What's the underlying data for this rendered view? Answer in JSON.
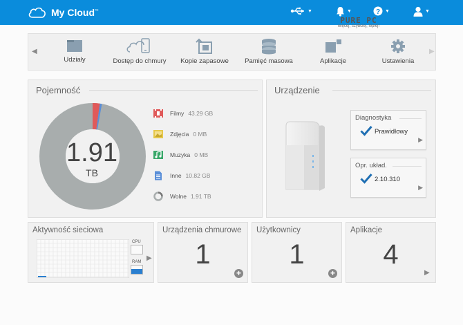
{
  "header": {
    "app_title": "My Cloud",
    "trademark": "™"
  },
  "watermark": {
    "brand": "PURE PC",
    "tagline": "więcej, szybciej, lepiej!"
  },
  "nav": {
    "items": [
      {
        "label": "Udziały",
        "icon": "folder-icon"
      },
      {
        "label": "Dostęp do chmury",
        "icon": "cloud-phone-icon"
      },
      {
        "label": "Kopie zapasowe",
        "icon": "backup-icon"
      },
      {
        "label": "Pamięć masowa",
        "icon": "storage-icon"
      },
      {
        "label": "Aplikacje",
        "icon": "apps-icon"
      },
      {
        "label": "Ustawienia",
        "icon": "gear-icon"
      }
    ]
  },
  "capacity": {
    "title": "Pojemność",
    "total_value": "1.91",
    "total_unit": "TB",
    "legend": [
      {
        "label": "Filmy",
        "value": "43.29 GB",
        "color": "#e05a5a"
      },
      {
        "label": "Zdjęcia",
        "value": "0 MB",
        "color": "#e6c84a"
      },
      {
        "label": "Muzyka",
        "value": "0 MB",
        "color": "#3aa86a"
      },
      {
        "label": "Inne",
        "value": "10.82 GB",
        "color": "#5a8fd8"
      },
      {
        "label": "Wolne",
        "value": "1.91 TB",
        "color": "#a8adad"
      }
    ]
  },
  "device": {
    "title": "Urządzenie",
    "diagnostics": {
      "title": "Diagnostyka",
      "value": "Prawidłowy"
    },
    "firmware": {
      "title": "Opr. układ.",
      "value": "2.10.310"
    }
  },
  "network": {
    "title": "Aktywność sieciowa",
    "cpu_label": "CPU",
    "ram_label": "RAM"
  },
  "cloud_devices": {
    "title": "Urządzenia chmurowe",
    "count": "1"
  },
  "users": {
    "title": "Użytkownicy",
    "count": "1"
  },
  "apps": {
    "title": "Aplikacje",
    "count": "4"
  },
  "colors": {
    "header_bg": "#0a8cdc",
    "donut_free": "#a8adad",
    "donut_movies": "#e05a5a",
    "donut_other": "#5a8fd8",
    "check": "#1f6fb3"
  }
}
